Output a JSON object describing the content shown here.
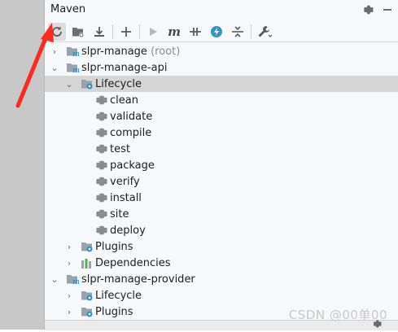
{
  "panel": {
    "title": "Maven"
  },
  "tree": {
    "root_suffix": "(root)",
    "rows": [
      {
        "label": "slpr-manage"
      },
      {
        "label": "slpr-manage-api"
      },
      {
        "label": "Lifecycle"
      },
      {
        "label": "clean"
      },
      {
        "label": "validate"
      },
      {
        "label": "compile"
      },
      {
        "label": "test"
      },
      {
        "label": "package"
      },
      {
        "label": "verify"
      },
      {
        "label": "install"
      },
      {
        "label": "site"
      },
      {
        "label": "deploy"
      },
      {
        "label": "Plugins"
      },
      {
        "label": "Dependencies"
      },
      {
        "label": "slpr-manage-provider"
      },
      {
        "label": "Lifecycle"
      },
      {
        "label": "Plugins"
      }
    ]
  },
  "watermark": "CSDN @00单00",
  "colors": {
    "accent_blue": "#3592c4",
    "arrow_red": "#ff2a1f",
    "selection": "#d5d5d5"
  }
}
